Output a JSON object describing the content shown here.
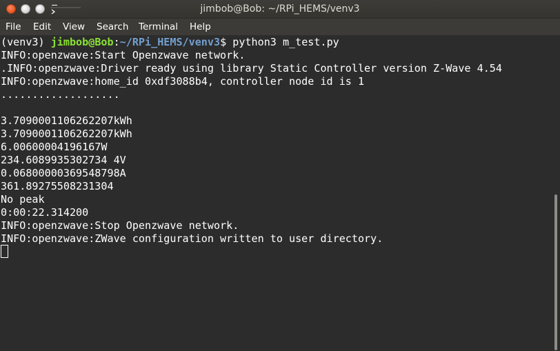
{
  "window": {
    "title": "jimbob@Bob: ~/RPi_HEMS/venv3"
  },
  "menu": {
    "items": [
      "File",
      "Edit",
      "View",
      "Search",
      "Terminal",
      "Help"
    ]
  },
  "terminal": {
    "prompt": {
      "venv": "(venv3) ",
      "user_host": "jimbob@Bob",
      "colon": ":",
      "path": "~/RPi_HEMS/venv3",
      "symbol": "$ ",
      "command": "python3 m_test.py"
    },
    "lines": [
      "INFO:openzwave:Start Openzwave network.",
      ".INFO:openzwave:Driver ready using library Static Controller version Z-Wave 4.54",
      "INFO:openzwave:home_id 0xdf3088b4, controller node id is 1",
      "...................",
      "",
      "3.7090001106262207kWh",
      "3.7090001106262207kWh",
      "6.00600004196167W",
      "234.6089935302734 4V",
      "0.06800000369548798A",
      "361.89275508231304",
      "No peak",
      "0:00:22.314200",
      "INFO:openzwave:Stop Openzwave network.",
      "INFO:openzwave:ZWave configuration written to user directory."
    ]
  },
  "colors": {
    "background": "#2c2c2c",
    "prompt_user": "#8ae234",
    "prompt_path": "#729fcf",
    "close_button": "#e9541f"
  }
}
